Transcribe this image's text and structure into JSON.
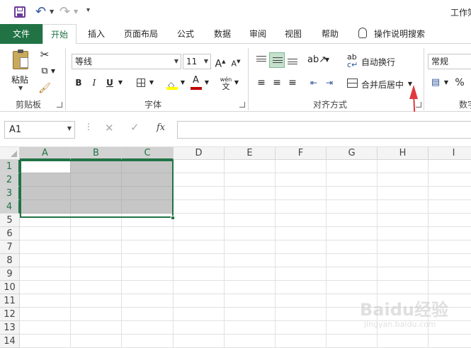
{
  "window": {
    "title_partial": "工作簿"
  },
  "tabs": [
    {
      "label": "文件"
    },
    {
      "label": "开始"
    },
    {
      "label": "插入"
    },
    {
      "label": "页面布局"
    },
    {
      "label": "公式"
    },
    {
      "label": "数据"
    },
    {
      "label": "审阅"
    },
    {
      "label": "视图"
    },
    {
      "label": "帮助"
    },
    {
      "label": "操作说明搜索"
    }
  ],
  "clipboard": {
    "paste_label": "粘贴",
    "group_label": "剪贴板"
  },
  "font": {
    "name": "等线",
    "size": "11",
    "group_label": "字体",
    "bold": "B",
    "italic": "I",
    "underline": "U",
    "grow": "A",
    "shrink": "A",
    "color_a": "A",
    "phonetic": "wén"
  },
  "alignment": {
    "wrap_label": "自动换行",
    "merge_label": "合并后居中",
    "group_label": "对齐方式"
  },
  "number": {
    "format": "常规",
    "percent": "%",
    "group_label_partial": "数字"
  },
  "formula_bar": {
    "name_box": "A1",
    "fx": "fx",
    "formula": ""
  },
  "columns": [
    "A",
    "B",
    "C",
    "D",
    "E",
    "F",
    "G",
    "H",
    "I"
  ],
  "rows": [
    "1",
    "2",
    "3",
    "4",
    "5",
    "6",
    "7",
    "8",
    "9",
    "10",
    "11",
    "12",
    "13",
    "14"
  ],
  "selection": "A1:C4",
  "colors": {
    "excel_green": "#217346",
    "selection_gray": "#c6c6c6",
    "arrow_red": "#e0393e"
  },
  "watermark": {
    "text": "Baidu经验",
    "url": "jingyan.baidu.com"
  }
}
